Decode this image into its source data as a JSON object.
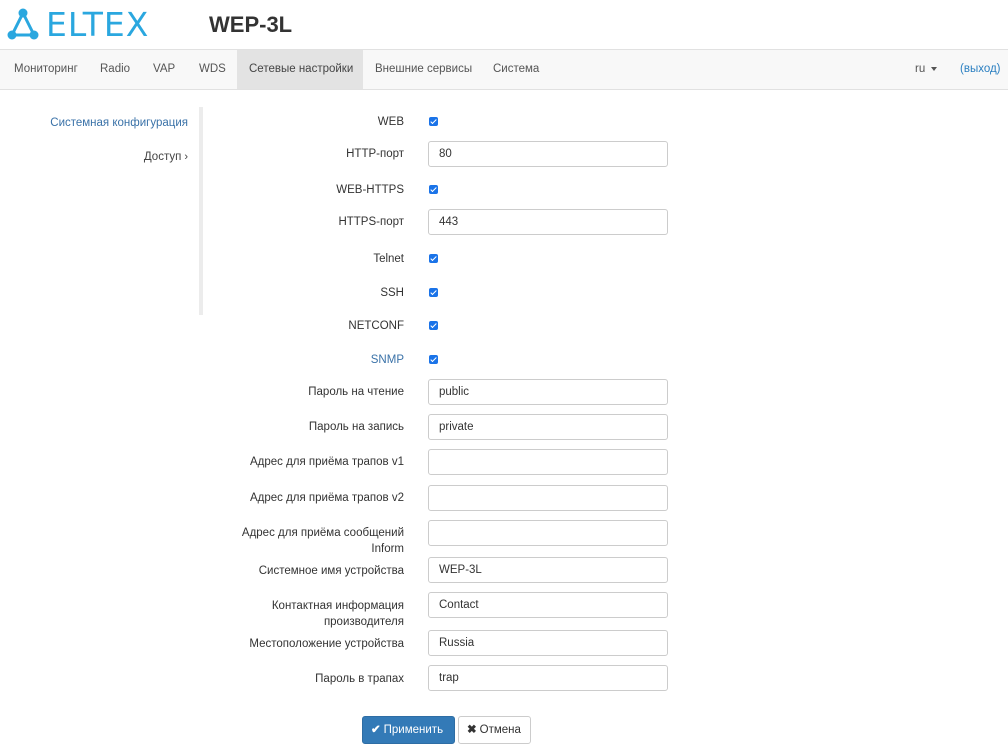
{
  "header": {
    "logo_text": "ELTEX",
    "device_title": "WEP-3L"
  },
  "navbar": {
    "items": [
      {
        "label": "Мониторинг"
      },
      {
        "label": "Radio"
      },
      {
        "label": "VAP"
      },
      {
        "label": "WDS"
      },
      {
        "label": "Сетевые настройки",
        "active": true
      },
      {
        "label": "Внешние сервисы"
      },
      {
        "label": "Система"
      }
    ],
    "language": "ru",
    "logout": "(выход)"
  },
  "sidebar": {
    "items": [
      {
        "label": "Системная конфигурация"
      },
      {
        "label": "Доступ"
      }
    ]
  },
  "form": {
    "web": {
      "label": "WEB",
      "checked": true
    },
    "http_port": {
      "label": "HTTP-порт",
      "value": "80"
    },
    "web_https": {
      "label": "WEB-HTTPS",
      "checked": true
    },
    "https_port": {
      "label": "HTTPS-порт",
      "value": "443"
    },
    "telnet": {
      "label": "Telnet",
      "checked": true
    },
    "ssh": {
      "label": "SSH",
      "checked": true
    },
    "netconf": {
      "label": "NETCONF",
      "checked": true
    },
    "snmp": {
      "label": "SNMP",
      "checked": true
    },
    "read_password": {
      "label": "Пароль на чтение",
      "value": "public"
    },
    "write_password": {
      "label": "Пароль на запись",
      "value": "private"
    },
    "trap_v1": {
      "label": "Адрес для приёма трапов v1",
      "value": ""
    },
    "trap_v2": {
      "label": "Адрес для приёма трапов v2",
      "value": ""
    },
    "inform": {
      "label_line1": "Адрес для приёма сообщений",
      "label_line2": "Inform",
      "value": ""
    },
    "sys_name": {
      "label": "Системное имя устройства",
      "value": "WEP-3L"
    },
    "contact": {
      "label_line1": "Контактная информация",
      "label_line2": "производителя",
      "value": "Contact"
    },
    "location": {
      "label": "Местоположение устройства",
      "value": "Russia"
    },
    "trap_password": {
      "label": "Пароль в трапах",
      "value": "trap"
    }
  },
  "buttons": {
    "apply": "Применить",
    "cancel": "Отмена"
  },
  "colors": {
    "brand": "#2aa7df",
    "primary_button": "#337ab7",
    "link": "#3a72a8",
    "checkbox": "#1a73e8"
  },
  "icons": {
    "apply": "check-icon",
    "cancel": "times-icon",
    "sidebar_access": "chevron-right-icon",
    "language": "caret-down-icon"
  }
}
